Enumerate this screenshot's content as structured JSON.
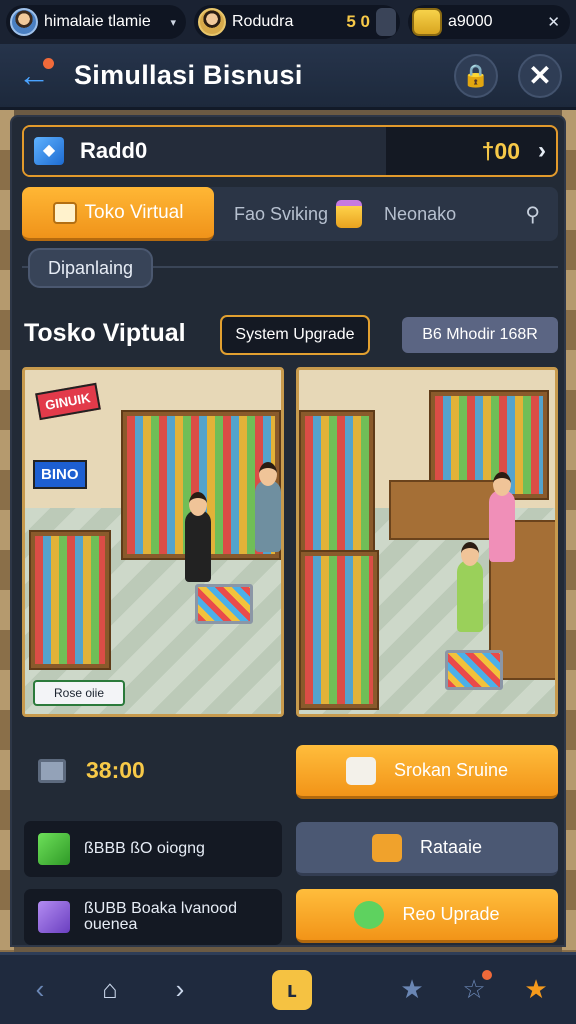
{
  "topbar": {
    "username": "himalaie tlamie",
    "username_caret": "▾",
    "coins_user": "Rodudra",
    "coins_value": "5 0",
    "cash_value": "a9000",
    "cash_close": "✕"
  },
  "header": {
    "back": "←",
    "title": "Simullasi Bisnusi",
    "lock": "🔒",
    "close": "✕"
  },
  "store_row": {
    "name": "Radd0",
    "price": "†00",
    "chevron": "›"
  },
  "tabs": {
    "active": "Toko Virtual",
    "tab2": "Fao Sviking",
    "tab3": "Neonako",
    "pin": "⚲"
  },
  "section": {
    "tag": "Dipanlaing"
  },
  "store": {
    "heading": "Tosko Viptual",
    "upgrade_tag": "System Upgrade",
    "info_tag": "B6 Mhodir 168R"
  },
  "scene_a": {
    "sign_top": "GINUIK",
    "sign_side": "BINO",
    "label": "Rose oiie"
  },
  "stat": {
    "value": "38:00"
  },
  "buttons": {
    "b1": "Srokan Sruine",
    "b2": "Rataaie",
    "b3": "Reo Uprade"
  },
  "resources": {
    "r1": "ßBBB ßO oiogng",
    "r2_line1": "ßUBB Boaka lvanood",
    "r2_line2": "ouenea"
  },
  "nav": {
    "back": "‹",
    "home": "⌂",
    "next": "›",
    "center": "ʟ",
    "star1": "★",
    "star2": "☆",
    "star3": "★"
  },
  "colors": {
    "accent_orange": "#f29418",
    "gold": "#f7c948",
    "panel": "#222a36",
    "header": "#26344b"
  }
}
